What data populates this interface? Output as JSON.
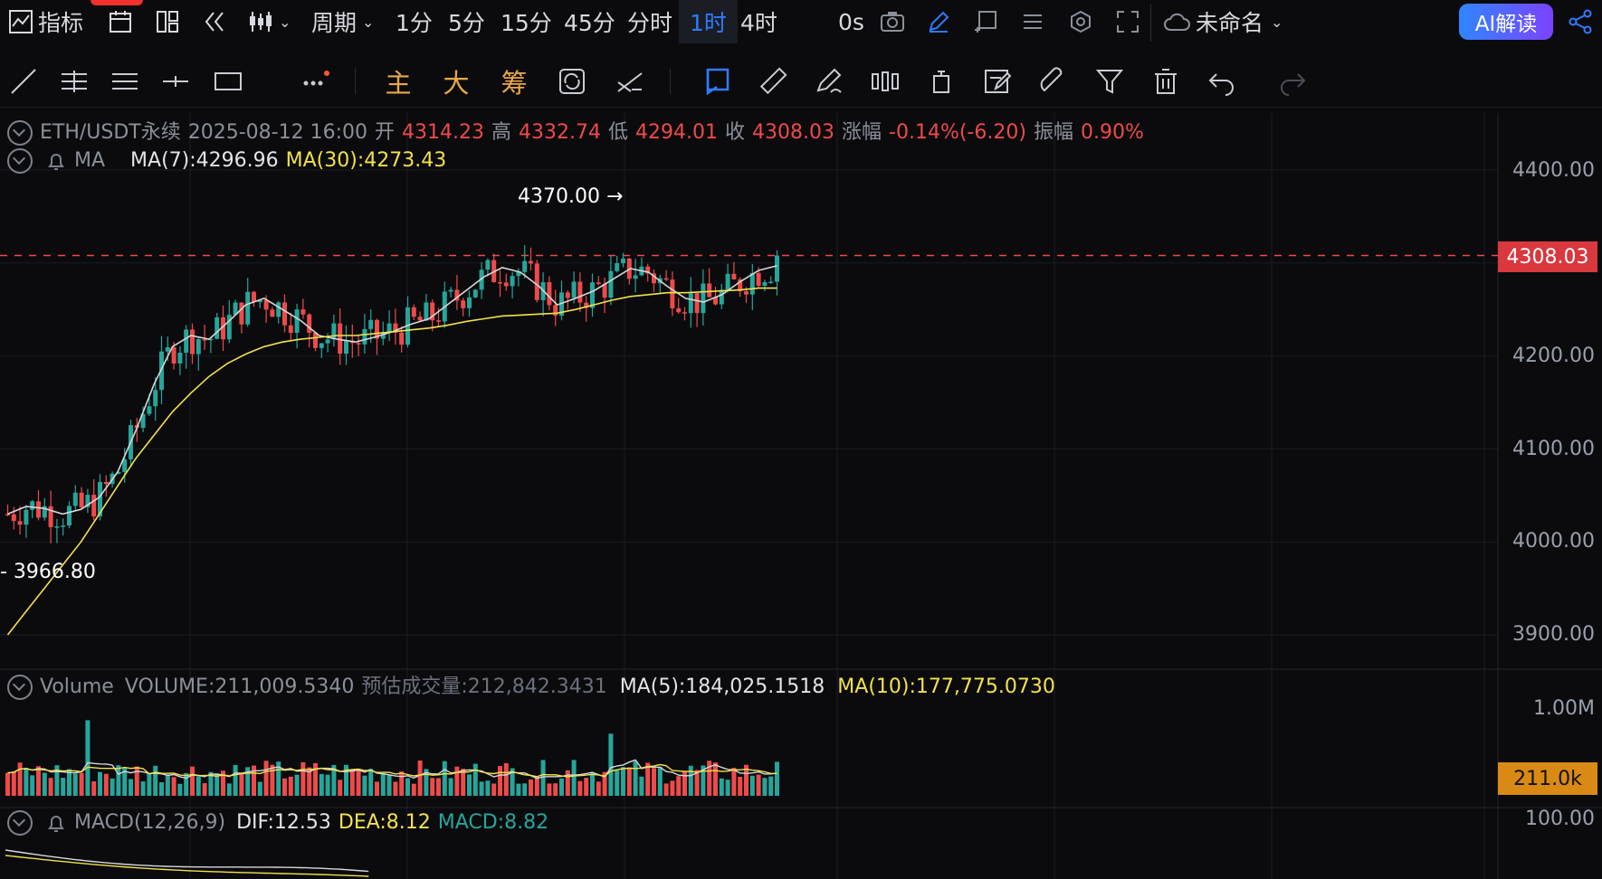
{
  "topbar": {
    "indicator_label": "指标",
    "period_label": "周期",
    "timeframes": [
      "1分",
      "5分",
      "15分",
      "45分",
      "分时",
      "1时",
      "4时"
    ],
    "active_timeframe": "1时",
    "countdown": "0s",
    "layout_name": "未命名",
    "ai_button": "AI解读"
  },
  "toolbar2": {
    "main_label": "主",
    "big_label": "大",
    "chip_label": "筹"
  },
  "info_row": {
    "symbol": "ETH/USDT永续",
    "datetime": "2025-08-12 16:00",
    "open_label": "开",
    "open": "4314.23",
    "high_label": "高",
    "high": "4332.74",
    "low_label": "低",
    "low": "4294.01",
    "close_label": "收",
    "close": "4308.03",
    "change_label": "涨幅",
    "change": "-0.14%(-6.20)",
    "amp_label": "振幅",
    "amp": "0.90%"
  },
  "ma_row": {
    "name": "MA",
    "ma7": "MA(7):4296.96",
    "ma30": "MA(30):4273.43"
  },
  "volume_row": {
    "name": "Volume",
    "volume": "VOLUME:211,009.5340",
    "est": "预估成交量:212,842.3431",
    "ma5": "MA(5):184,025.1518",
    "ma10": "MA(10):177,775.0730"
  },
  "macd_row": {
    "name": "MACD(12,26,9)",
    "dif": "DIF:12.53",
    "dea": "DEA:8.12",
    "macd": "MACD:8.82"
  },
  "price_axis": [
    "4400.00",
    "4200.00",
    "4100.00",
    "4000.00",
    "3900.00"
  ],
  "volume_axis": [
    "1.00M",
    "100.00"
  ],
  "last_price_tag": "4308.03",
  "last_volume_tag": "211.0k",
  "annotations": {
    "high_mark": "4370.00 →",
    "low_mark": "- 3966.80"
  },
  "colors": {
    "up": "#26a69a",
    "down": "#ef4a4a",
    "ma7": "#d7d7d7",
    "ma30": "#f2e24c",
    "accent": "#2f7bff"
  },
  "chart_data": {
    "type": "candlestick",
    "price_range": [
      3880,
      4420
    ],
    "series": [
      {
        "name": "MA(7)",
        "values": [
          4030,
          4038,
          4036,
          4030,
          4035,
          4048,
          4075,
          4120,
          4170,
          4210,
          4222,
          4218,
          4236,
          4255,
          4262,
          4250,
          4238,
          4222,
          4218,
          4215,
          4220,
          4226,
          4234,
          4240,
          4255,
          4270,
          4285,
          4295,
          4290,
          4275,
          4255,
          4262,
          4270,
          4282,
          4294,
          4290,
          4275,
          4262,
          4258,
          4266,
          4280,
          4292,
          4297
        ]
      },
      {
        "name": "MA(30)",
        "values": [
          3900,
          3925,
          3950,
          3975,
          4000,
          4030,
          4060,
          4090,
          4115,
          4140,
          4160,
          4178,
          4192,
          4202,
          4210,
          4215,
          4218,
          4220,
          4222,
          4222,
          4224,
          4226,
          4228,
          4230,
          4233,
          4237,
          4240,
          4243,
          4244,
          4245,
          4246,
          4250,
          4255,
          4260,
          4264,
          4266,
          4268,
          4268,
          4269,
          4270,
          4271,
          4273,
          4273
        ]
      }
    ],
    "last_close": 4308.03,
    "high": 4370.0,
    "low": 3966.8
  }
}
